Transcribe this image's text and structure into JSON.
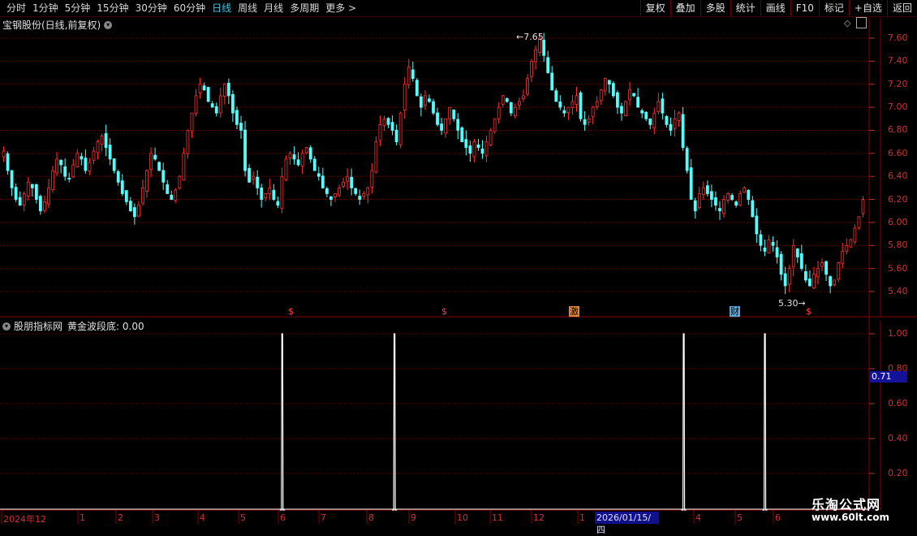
{
  "toolbar": {
    "periods": [
      "分时",
      "1分钟",
      "5分钟",
      "15分钟",
      "30分钟",
      "60分钟",
      "日线",
      "周线",
      "月线",
      "多周期",
      "更多 >"
    ],
    "active_period": "日线",
    "right_buttons": [
      "复权",
      "叠加",
      "多股",
      "统计",
      "画线",
      "F10",
      "标记",
      "+自选",
      "返回"
    ]
  },
  "main_panel": {
    "title": "宝钢股份(日线,前复权)",
    "high_label": "7.65",
    "low_label": "5.30",
    "events": [
      {
        "label": "$",
        "color": "#ff4040",
        "bg": "#000"
      },
      {
        "label": "$",
        "color": "#ff4040",
        "bg": "#000"
      },
      {
        "label": "激",
        "color": "#000",
        "bg": "#e08a3a"
      },
      {
        "label": "财",
        "color": "#000",
        "bg": "#58a8e0"
      },
      {
        "label": "$",
        "color": "#ff4040",
        "bg": "#000"
      }
    ]
  },
  "indicator_panel": {
    "title": "股朋指标网",
    "indicator_label": "黄金波段底: 0.00",
    "marker_value": "0.71"
  },
  "price_axis": {
    "ticks": [
      "7.60",
      "7.40",
      "7.20",
      "7.00",
      "6.80",
      "6.60",
      "6.40",
      "6.20",
      "6.00",
      "5.80",
      "5.60",
      "5.40"
    ]
  },
  "indicator_axis": {
    "ticks": [
      "1.00",
      "0.80",
      "0.60",
      "0.40",
      "0.20"
    ]
  },
  "time_axis": {
    "labels": [
      "2024年12",
      "1",
      "2",
      "3",
      "4",
      "5",
      "6",
      "7",
      "8",
      "9",
      "10",
      "11",
      "12",
      "1",
      "4",
      "5",
      "6"
    ],
    "cursor_date": "2026/01/15/四"
  },
  "watermark": {
    "line1": "乐淘公式网",
    "line2": "www.60lt.com"
  },
  "colors": {
    "up": "#ff3232",
    "down": "#54fcfc",
    "grid": "#7a0000",
    "signal": "#ffffff"
  },
  "chart_data": {
    "type": "candlestick",
    "price_range": [
      5.3,
      7.65
    ],
    "closes": [
      6.62,
      6.45,
      6.3,
      6.2,
      6.15,
      6.25,
      6.35,
      6.3,
      6.2,
      6.1,
      6.18,
      6.3,
      6.45,
      6.55,
      6.5,
      6.4,
      6.38,
      6.5,
      6.6,
      6.55,
      6.45,
      6.52,
      6.62,
      6.7,
      6.75,
      6.65,
      6.55,
      6.45,
      6.35,
      6.25,
      6.18,
      6.1,
      6.05,
      6.15,
      6.3,
      6.45,
      6.6,
      6.55,
      6.45,
      6.35,
      6.25,
      6.2,
      6.28,
      6.4,
      6.6,
      6.8,
      6.95,
      7.1,
      7.2,
      7.15,
      7.05,
      7.0,
      6.95,
      7.1,
      7.2,
      7.1,
      6.95,
      6.85,
      6.8,
      6.45,
      6.35,
      6.4,
      6.3,
      6.2,
      6.25,
      6.3,
      6.2,
      6.15,
      6.4,
      6.55,
      6.6,
      6.55,
      6.5,
      6.6,
      6.65,
      6.55,
      6.45,
      6.4,
      6.3,
      6.25,
      6.2,
      6.25,
      6.3,
      6.35,
      6.4,
      6.3,
      6.25,
      6.2,
      6.25,
      6.3,
      6.45,
      6.7,
      6.85,
      6.9,
      6.85,
      6.8,
      6.7,
      6.95,
      7.2,
      7.35,
      7.25,
      7.1,
      7.0,
      7.1,
      7.05,
      6.95,
      6.85,
      6.8,
      6.9,
      7.0,
      6.9,
      6.8,
      6.7,
      6.65,
      6.6,
      6.7,
      6.65,
      6.6,
      6.7,
      6.8,
      6.9,
      7.0,
      7.1,
      7.05,
      6.95,
      7.0,
      7.05,
      7.1,
      7.25,
      7.4,
      7.5,
      7.6,
      7.45,
      7.3,
      7.15,
      7.05,
      7.0,
      6.95,
      7.0,
      7.05,
      7.1,
      6.9,
      6.85,
      6.9,
      7.0,
      7.05,
      7.15,
      7.25,
      7.2,
      7.1,
      7.0,
      6.95,
      7.05,
      7.15,
      7.1,
      7.0,
      6.95,
      6.9,
      6.85,
      6.95,
      7.05,
      6.95,
      6.85,
      6.8,
      6.9,
      6.95,
      6.65,
      6.45,
      6.2,
      6.1,
      6.25,
      6.3,
      6.25,
      6.2,
      6.15,
      6.1,
      6.2,
      6.25,
      6.2,
      6.15,
      6.25,
      6.3,
      6.2,
      6.05,
      5.9,
      5.8,
      5.75,
      5.85,
      5.8,
      5.7,
      5.55,
      5.45,
      5.6,
      5.8,
      5.7,
      5.6,
      5.5,
      5.45,
      5.55,
      5.6,
      5.65,
      5.55,
      5.45,
      5.5,
      5.65,
      5.75,
      5.8,
      5.85,
      5.95,
      6.05,
      6.2
    ]
  },
  "signal_data": {
    "type": "spike",
    "value": 1.0,
    "positions": [
      0.325,
      0.455,
      0.79,
      0.884
    ]
  }
}
